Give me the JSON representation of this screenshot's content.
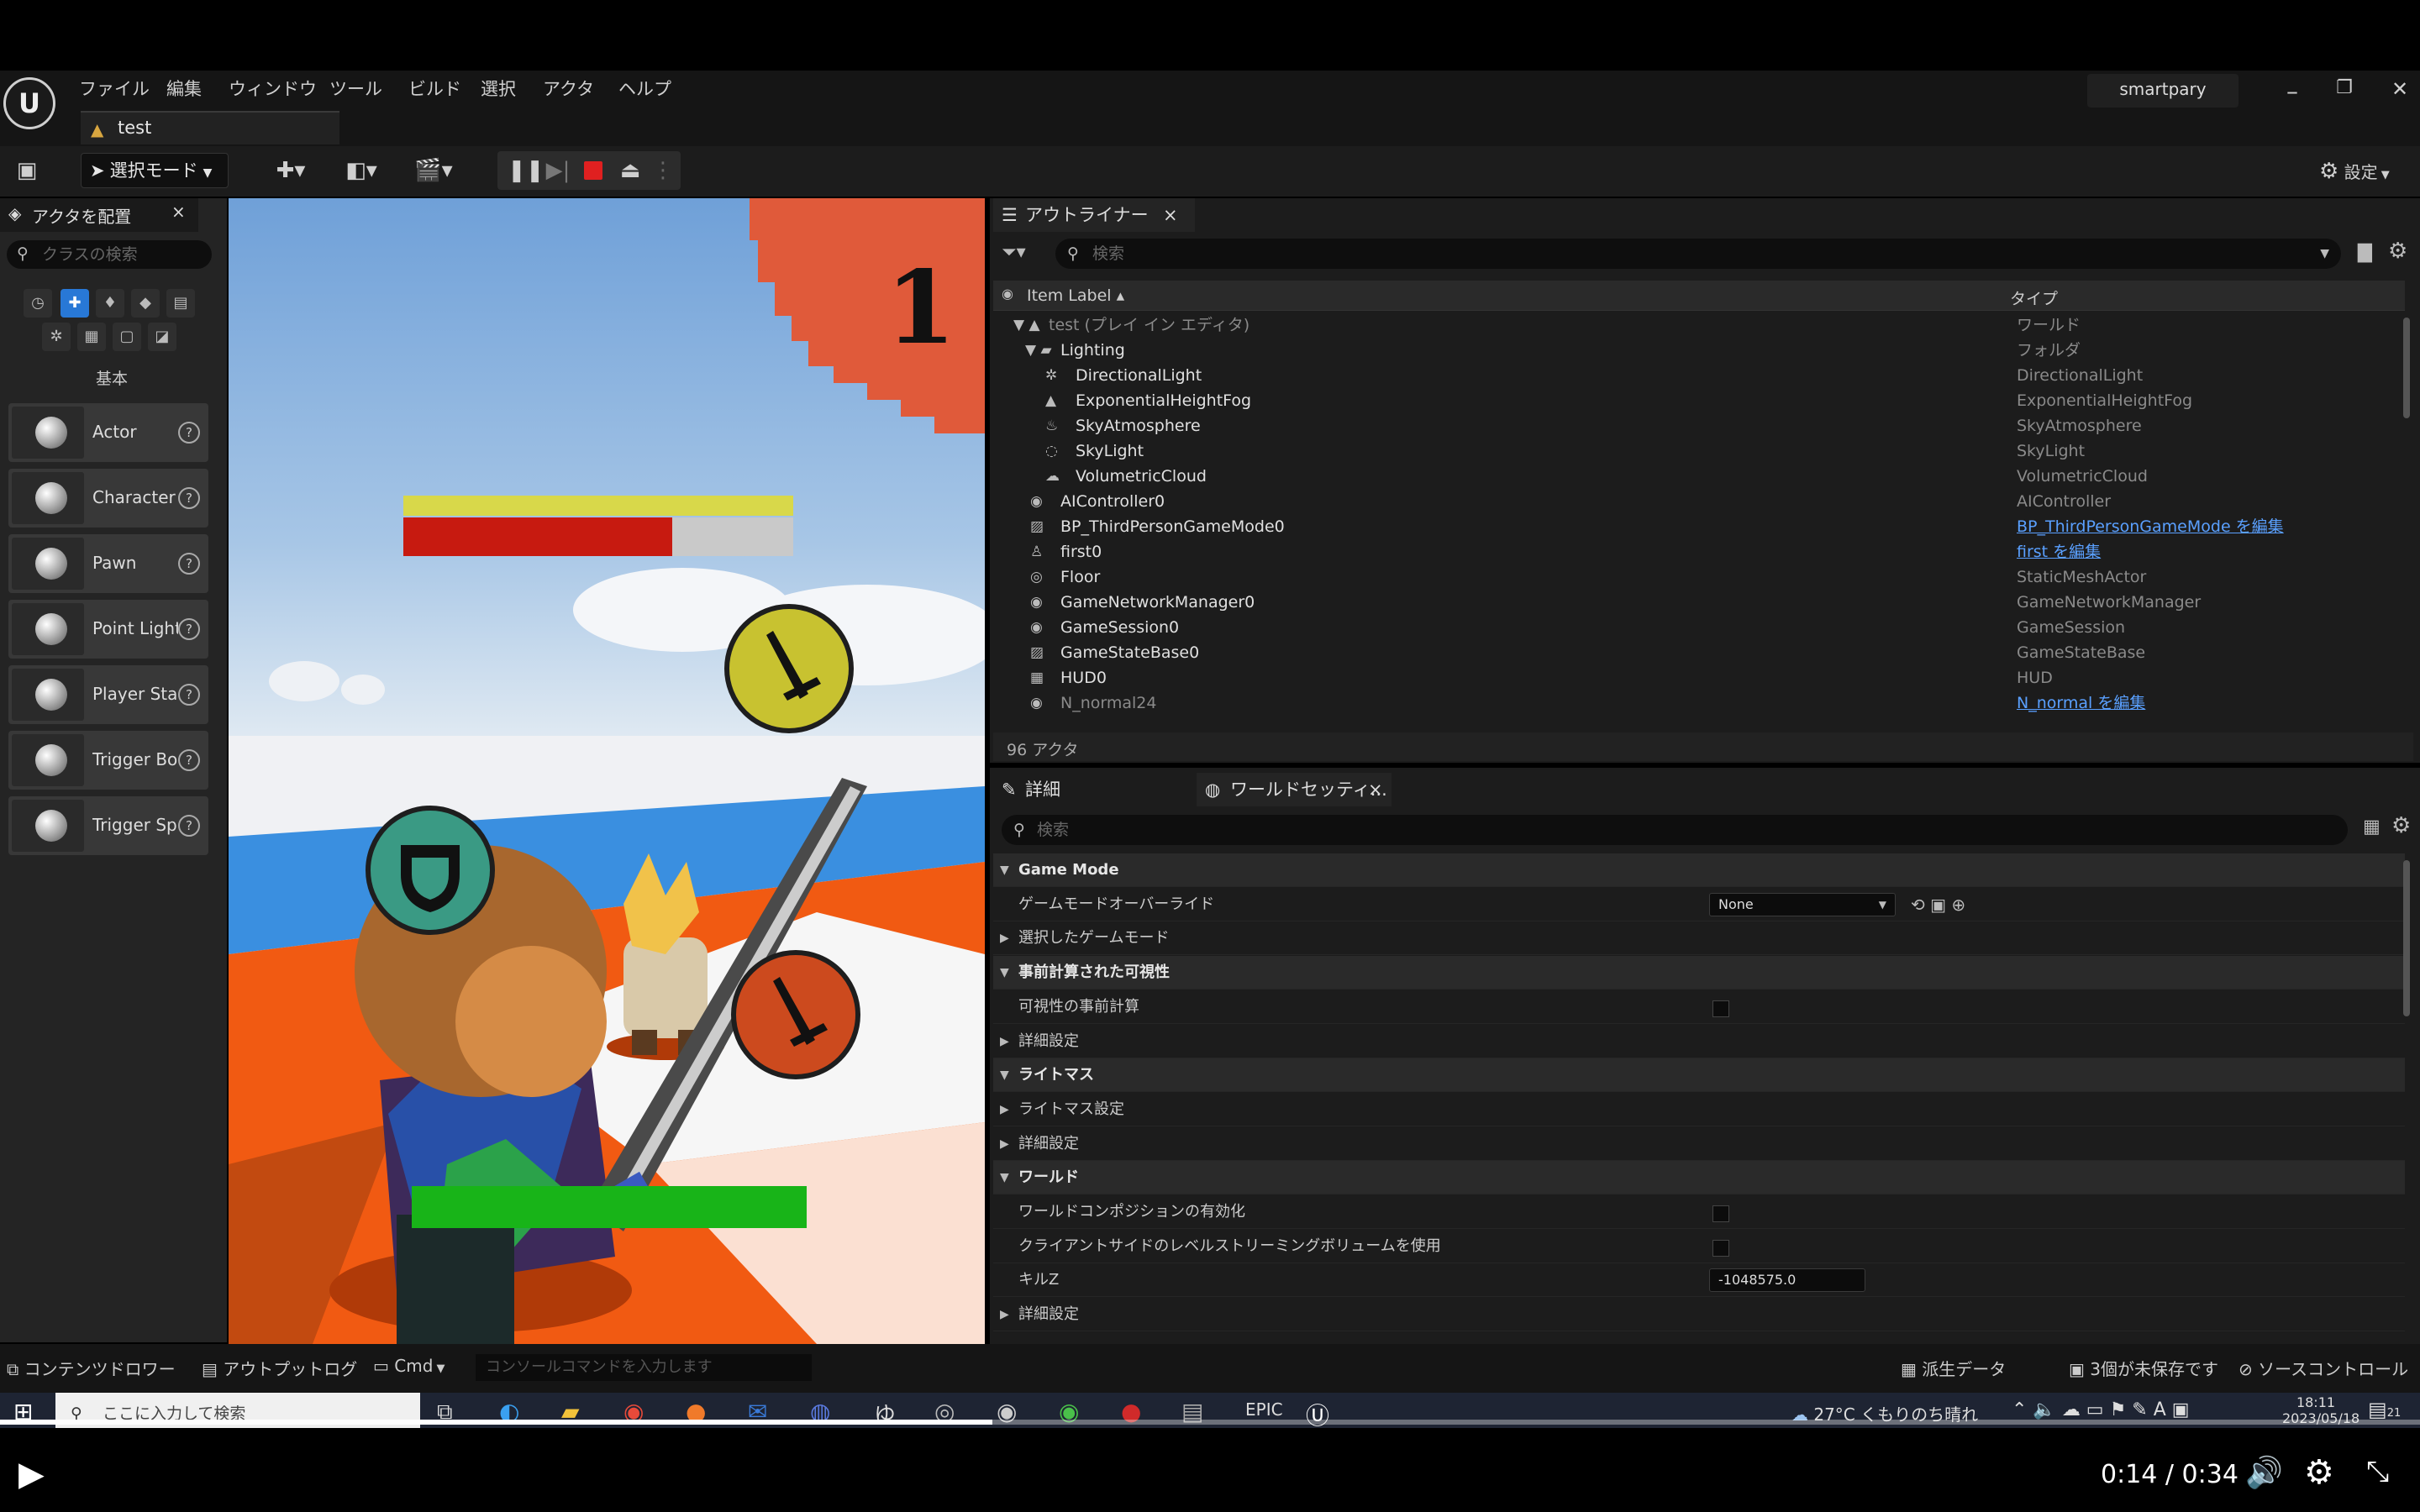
{
  "menubar": {
    "logo_text": "U",
    "items": [
      "ファイル",
      "編集",
      "ウィンドウ",
      "ツール",
      "ビルド",
      "選択",
      "アクタ",
      "ヘルプ"
    ],
    "user": "smartpary",
    "controls": [
      "–",
      "❐",
      "✕"
    ]
  },
  "tab": {
    "label": "test"
  },
  "toolbar": {
    "mode_label": "選択モード",
    "settings_label": "設定"
  },
  "place_actors": {
    "title": "アクタを配置",
    "close": "×",
    "search_placeholder": "クラスの検索",
    "category_label": "基本",
    "actors": [
      "Actor",
      "Character",
      "Pawn",
      "Point Light",
      "Player Star",
      "Trigger Bo",
      "Trigger Sp"
    ]
  },
  "game": {
    "timer": "1",
    "enemy_health_fraction": 0.69,
    "player_health_fraction": 1.0
  },
  "outliner": {
    "title": "アウトライナー",
    "close": "×",
    "search_placeholder": "検索",
    "col_label": "Item Label ▴",
    "col_type": "タイプ",
    "rows": [
      {
        "name": "test (プレイ イン エディタ)",
        "type": "ワールド",
        "dim": true
      },
      {
        "name": "Lighting",
        "type": "フォルダ"
      },
      {
        "name": "DirectionalLight",
        "type": "DirectionalLight"
      },
      {
        "name": "ExponentialHeightFog",
        "type": "ExponentialHeightFog"
      },
      {
        "name": "SkyAtmosphere",
        "type": "SkyAtmosphere"
      },
      {
        "name": "SkyLight",
        "type": "SkyLight"
      },
      {
        "name": "VolumetricCloud",
        "type": "VolumetricCloud"
      },
      {
        "name": "AIController0",
        "type": "AIController"
      },
      {
        "name": "BP_ThirdPersonGameMode0",
        "type": "BP_ThirdPersonGameMode を編集",
        "link": true
      },
      {
        "name": "first0",
        "type": "first を編集",
        "link": true
      },
      {
        "name": "Floor",
        "type": "StaticMeshActor"
      },
      {
        "name": "GameNetworkManager0",
        "type": "GameNetworkManager"
      },
      {
        "name": "GameSession0",
        "type": "GameSession"
      },
      {
        "name": "GameStateBase0",
        "type": "GameStateBase"
      },
      {
        "name": "HUD0",
        "type": "HUD"
      },
      {
        "name": "N_normal24",
        "type": "N_normal を編集",
        "link": true,
        "dim": true
      }
    ],
    "count_label": "96 アクタ"
  },
  "details": {
    "tab1": "詳細",
    "tab2": "ワールドセッティ...",
    "close": "×",
    "search_placeholder": "検索",
    "rows": [
      {
        "label": "Game Mode",
        "cat": true
      },
      {
        "label": "ゲームモードオーバーライド",
        "value": "None",
        "dropdown": true
      },
      {
        "label": "選択したゲームモード",
        "collapsed": true
      },
      {
        "label": "事前計算された可視性",
        "cat": true
      },
      {
        "label": "可視性の事前計算",
        "checkbox": true
      },
      {
        "label": "詳細設定",
        "collapsed": true
      },
      {
        "label": "ライトマス",
        "cat": true
      },
      {
        "label": "ライトマス設定",
        "collapsed": true
      },
      {
        "label": "詳細設定",
        "collapsed": true
      },
      {
        "label": "ワールド",
        "cat": true
      },
      {
        "label": "ワールドコンポジションの有効化",
        "checkbox": true
      },
      {
        "label": "クライアントサイドのレベルストリーミングボリュームを使用",
        "checkbox": true
      },
      {
        "label": "キルZ",
        "value": "-1048575.0"
      },
      {
        "label": "詳細設定",
        "collapsed": true
      }
    ]
  },
  "bottombar": {
    "content_drawer": "コンテンツドロワー",
    "output_log": "アウトプットログ",
    "cmd": "Cmd",
    "console_placeholder": "コンソールコマンドを入力します",
    "derived_data": "派生データ",
    "unsaved": "3個が未保存です",
    "source_control": "ソースコントロール"
  },
  "taskbar": {
    "search_placeholder": "ここに入力して検索",
    "weather": "27°C  くもりのち晴れ",
    "time": "18:11",
    "date": "2023/05/18",
    "notifications": "21"
  },
  "player": {
    "time": "0:14 / 0:34",
    "progress_fraction": 0.41
  },
  "colors": {
    "accent": "#2878d6",
    "link": "#5aa0ff",
    "health_red": "#c71a10",
    "health_green": "#18b418"
  }
}
